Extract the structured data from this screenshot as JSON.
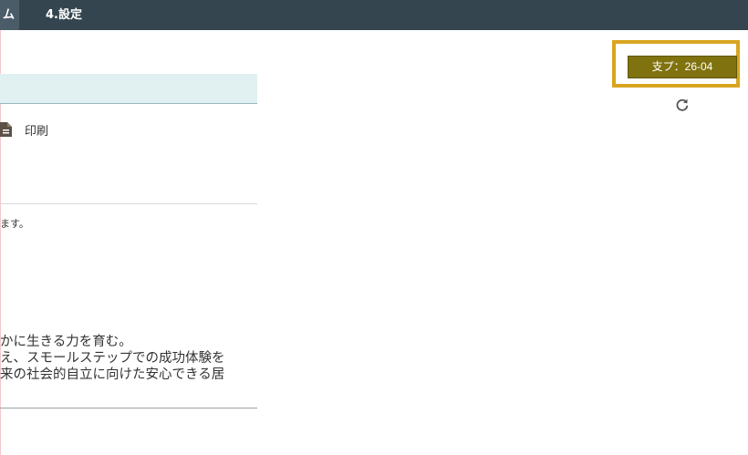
{
  "nav": {
    "active_tab_fragment": "ム",
    "settings_tab": "4.設定"
  },
  "toolbar": {
    "print_label": "印刷",
    "print_icon": "document-icon"
  },
  "content": {
    "note_fragment": "ます。",
    "policy_lines": [
      "かに生きる力を育む。",
      "え、スモールステップでの成功体験を",
      "来の社会的自立に向けた安心できる居"
    ]
  },
  "badge": {
    "label": "支プ：26-04",
    "color": "#80730f",
    "highlight_color": "#d9a521"
  },
  "refresh": {
    "icon": "refresh-icon"
  }
}
